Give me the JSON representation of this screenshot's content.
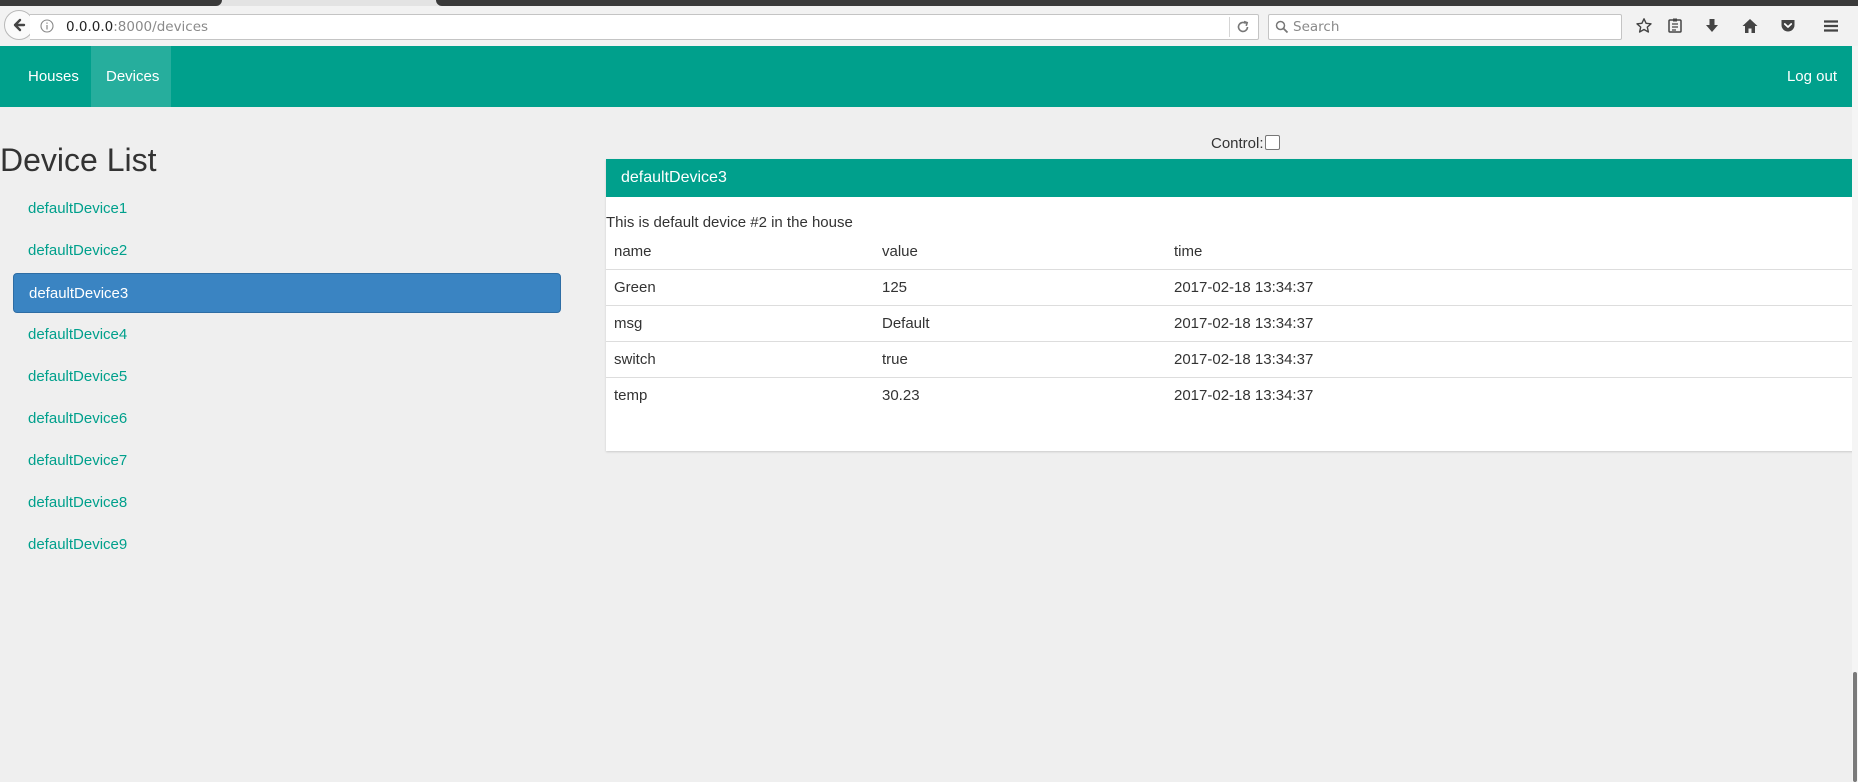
{
  "browser": {
    "url_host": "0.0.0.0",
    "url_rest": ":8000/devices",
    "search_placeholder": "Search"
  },
  "nav": {
    "items": [
      {
        "label": "Houses"
      },
      {
        "label": "Devices"
      }
    ],
    "logout_label": "Log out",
    "accent_color": "#00a08c"
  },
  "device_list": {
    "title": "Device List",
    "items": [
      {
        "label": "defaultDevice1"
      },
      {
        "label": "defaultDevice2"
      },
      {
        "label": "defaultDevice3"
      },
      {
        "label": "defaultDevice4"
      },
      {
        "label": "defaultDevice5"
      },
      {
        "label": "defaultDevice6"
      },
      {
        "label": "defaultDevice7"
      },
      {
        "label": "defaultDevice8"
      },
      {
        "label": "defaultDevice9"
      }
    ],
    "selected": "defaultDevice3",
    "selected_color": "#3a84c2"
  },
  "control": {
    "label": "Control:",
    "checked": false
  },
  "device_panel": {
    "title": "defaultDevice3",
    "description": "This is default device #2 in the house",
    "columns": [
      "name",
      "value",
      "time"
    ],
    "rows": [
      {
        "name": "Green",
        "value": "125",
        "time": "2017-02-18 13:34:37"
      },
      {
        "name": "msg",
        "value": "Default",
        "time": "2017-02-18 13:34:37"
      },
      {
        "name": "switch",
        "value": "true",
        "time": "2017-02-18 13:34:37"
      },
      {
        "name": "temp",
        "value": "30.23",
        "time": "2017-02-18 13:34:37"
      }
    ]
  }
}
